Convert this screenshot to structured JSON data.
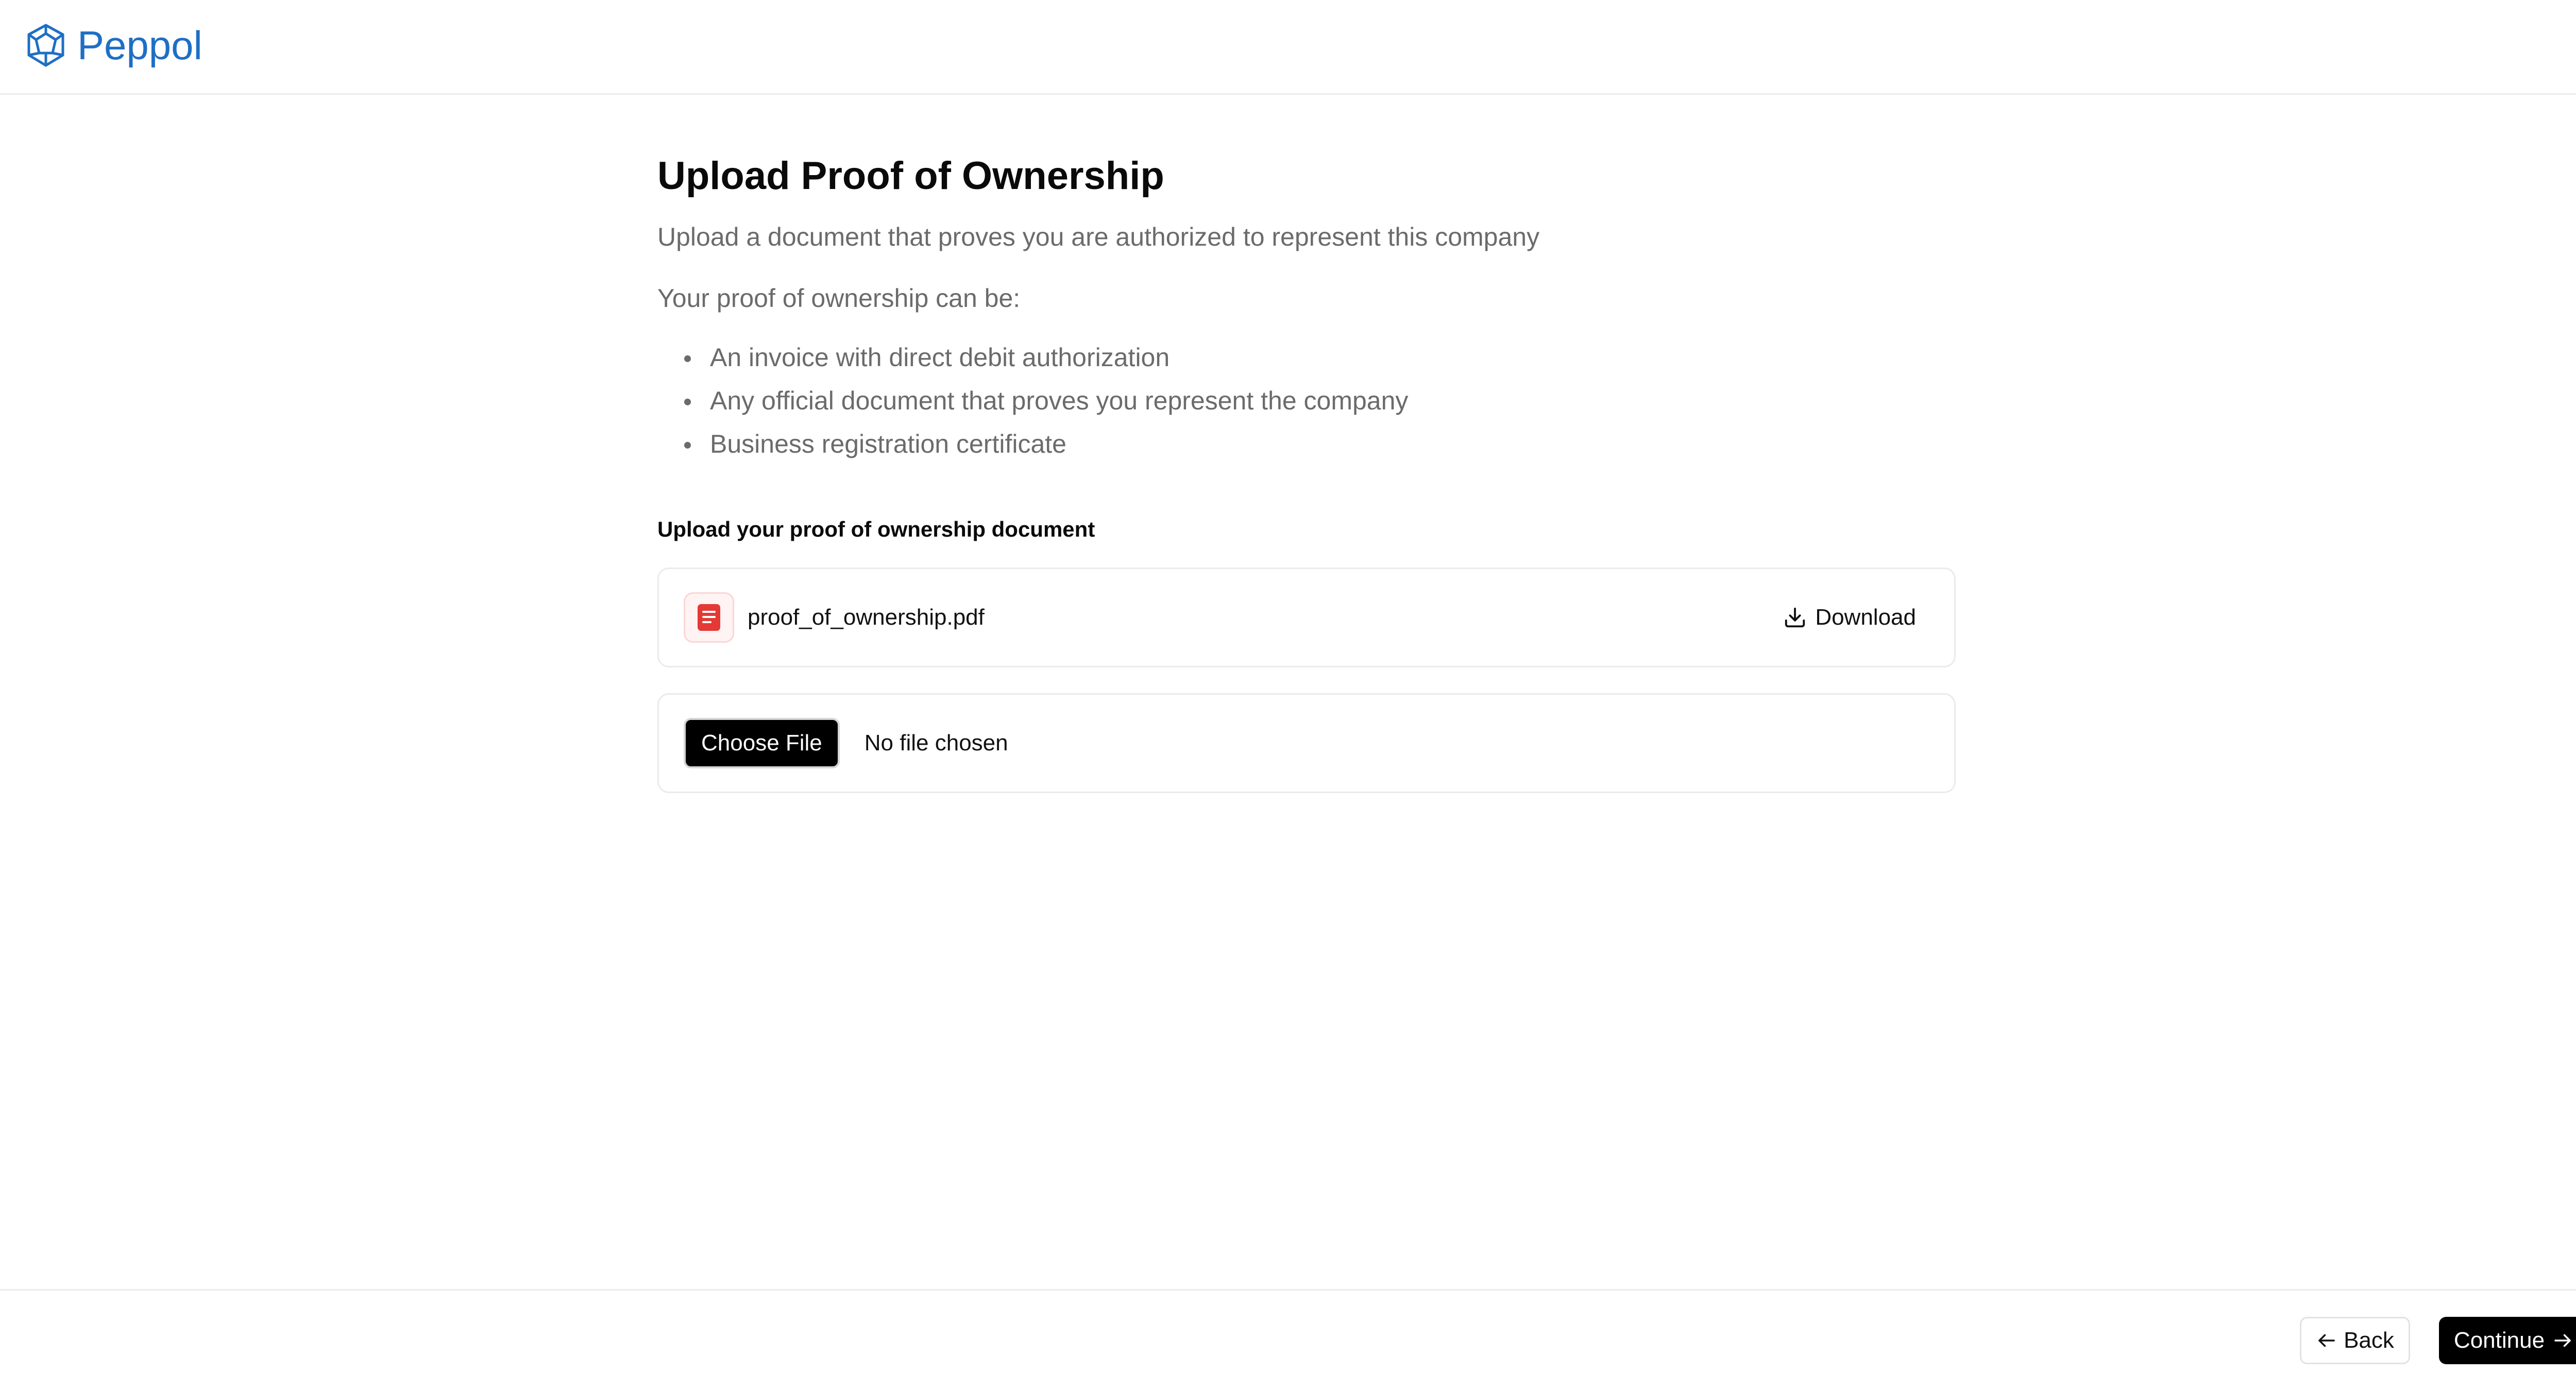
{
  "header": {
    "brand_name": "Peppol",
    "logo_icon": "peppol-logo-icon",
    "brand_color": "#1e6fc4"
  },
  "main": {
    "title": "Upload Proof of Ownership",
    "subtitle": "Upload a document that proves you are authorized to represent this company",
    "intro": "Your proof of ownership can be:",
    "bullets": [
      "An invoice with direct debit authorization",
      "Any official document that proves you represent the company",
      "Business registration certificate"
    ],
    "upload_label": "Upload your proof of ownership document",
    "uploaded_file": {
      "name": "proof_of_ownership.pdf",
      "icon": "pdf-file-icon",
      "icon_color": "#e53935",
      "download_label": "Download",
      "download_icon": "download-icon"
    },
    "file_input": {
      "button_label": "Choose File",
      "status": "No file chosen"
    }
  },
  "footer": {
    "back_label": "Back",
    "back_icon": "arrow-left-icon",
    "continue_label": "Continue",
    "continue_icon": "arrow-right-icon"
  }
}
